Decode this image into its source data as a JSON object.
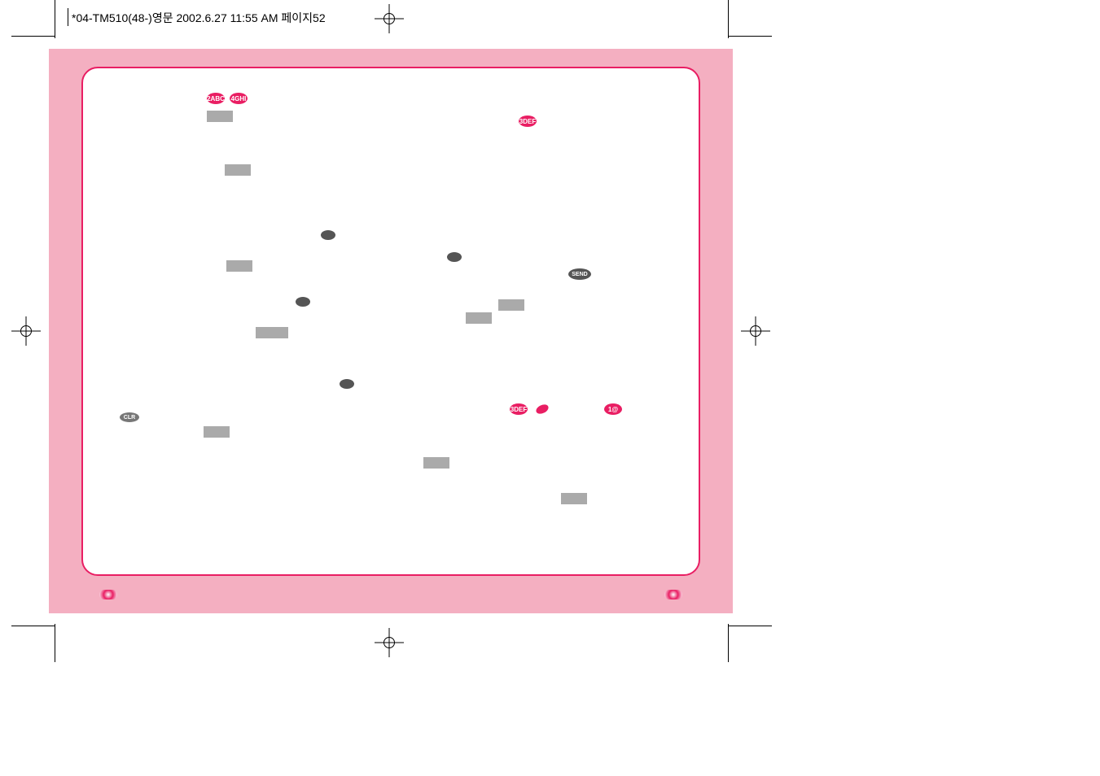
{
  "header": {
    "filename": "*04-TM510(48-)영문  2002.6.27 11:55 AM  페이지52"
  },
  "keys": {
    "k2": "2ABC",
    "k4": "4GHI",
    "k3a": "3DEF",
    "k3b": "3DEF",
    "k1": "1@",
    "send": "SEND",
    "clr": "CLR"
  }
}
